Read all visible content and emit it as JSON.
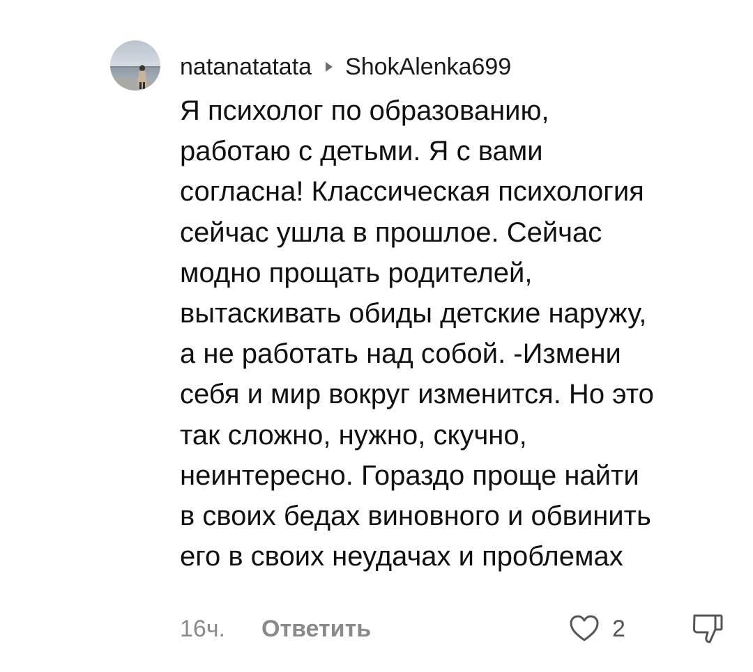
{
  "comment": {
    "author": "natanatatata",
    "reply_to": "ShokAlenka699",
    "lines": [
      "Я психолог по образованию,",
      "работаю с детьми. Я с вами",
      "согласна! Классическая психология",
      "сейчас ушла в прошлое. Сейчас",
      "модно прощать родителей,",
      "вытаскивать обиды детские наружу,",
      "а не работать над собой. -Измени",
      "себя и мир вокруг изменится. Но это",
      "так сложно, нужно, скучно,",
      "неинтересно. Гораздо проще найти",
      "в своих бедах виновного и обвинить",
      "его в своих неудачах и проблемах"
    ],
    "time": "16ч.",
    "reply_label": "Ответить",
    "likes": "2"
  },
  "icons": {
    "reply_arrow": "triangle-right-icon",
    "like": "heart-outline-icon",
    "dislike": "thumbs-down-outline-icon"
  },
  "colors": {
    "text": "#111111",
    "muted": "#8a8a8a",
    "icon": "#555555"
  }
}
